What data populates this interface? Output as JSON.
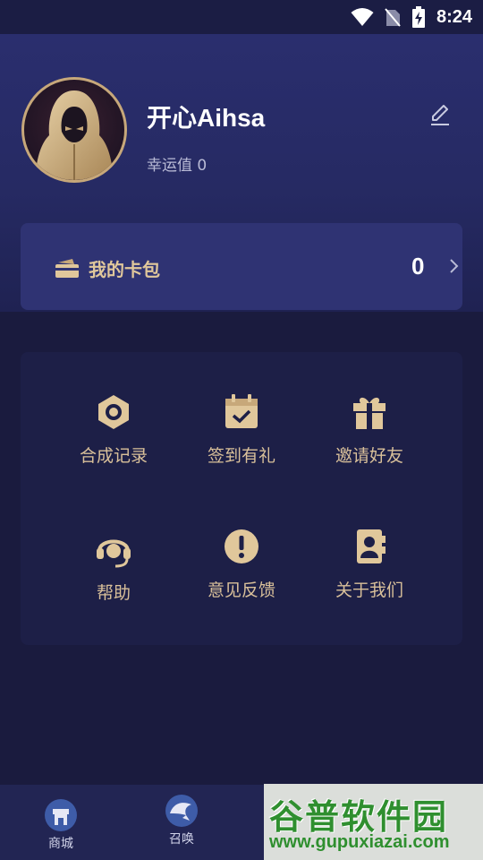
{
  "status_bar": {
    "time": "8:24"
  },
  "profile": {
    "username": "开心Aihsa",
    "luck_text": "幸运值 0"
  },
  "wallet": {
    "label": "我的卡包",
    "count": "0"
  },
  "menu": {
    "items": [
      {
        "label": "合成记录",
        "icon": "synthesis-record-icon"
      },
      {
        "label": "签到有礼",
        "icon": "calendar-checkin-icon"
      },
      {
        "label": "邀请好友",
        "icon": "gift-icon"
      },
      {
        "label": "帮助",
        "icon": "headset-icon"
      },
      {
        "label": "意见反馈",
        "icon": "exclamation-icon"
      },
      {
        "label": "关于我们",
        "icon": "contact-card-icon"
      }
    ]
  },
  "tabs": [
    {
      "label": "商城",
      "icon": "shop-icon"
    },
    {
      "label": "召唤",
      "icon": "eagle-icon"
    }
  ],
  "watermark": {
    "title": "谷普软件园",
    "url": "www.gupuxiazai.com"
  },
  "colors": {
    "accent_gold": "#e0c79b",
    "header_top": "#2a2e6e",
    "card_bg": "#2f3373",
    "page_bg": "#1a1b3e"
  }
}
